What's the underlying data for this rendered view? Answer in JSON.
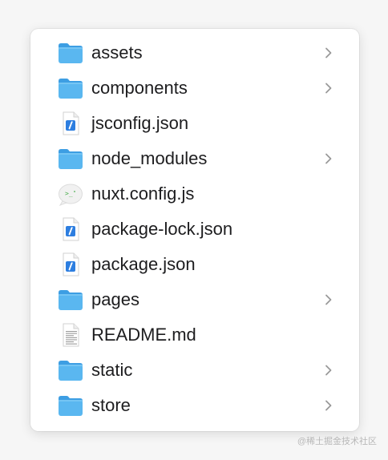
{
  "file_list": {
    "items": [
      {
        "name": "assets",
        "kind": "folder",
        "has_chevron": true
      },
      {
        "name": "components",
        "kind": "folder",
        "has_chevron": true
      },
      {
        "name": "jsconfig.json",
        "kind": "json",
        "has_chevron": false
      },
      {
        "name": "node_modules",
        "kind": "folder",
        "has_chevron": true
      },
      {
        "name": "nuxt.config.js",
        "kind": "js",
        "has_chevron": false
      },
      {
        "name": "package-lock.json",
        "kind": "json",
        "has_chevron": false
      },
      {
        "name": "package.json",
        "kind": "json",
        "has_chevron": false
      },
      {
        "name": "pages",
        "kind": "folder",
        "has_chevron": true
      },
      {
        "name": "README.md",
        "kind": "markdown",
        "has_chevron": false
      },
      {
        "name": "static",
        "kind": "folder",
        "has_chevron": true
      },
      {
        "name": "store",
        "kind": "folder",
        "has_chevron": true
      }
    ]
  },
  "icons": {
    "folder": "folder-icon",
    "json": "json-file-icon",
    "js": "js-file-icon",
    "markdown": "markdown-file-icon",
    "chevron": "chevron-right-icon"
  },
  "colors": {
    "folder_body": "#5ab7f0",
    "folder_tab": "#3d9ee3",
    "json_badge": "#2d7ee0",
    "js_text": "#4caf50",
    "text": "#1d1d1f",
    "chevron": "#9a9a9a"
  },
  "watermark": "@稀土掘金技术社区"
}
